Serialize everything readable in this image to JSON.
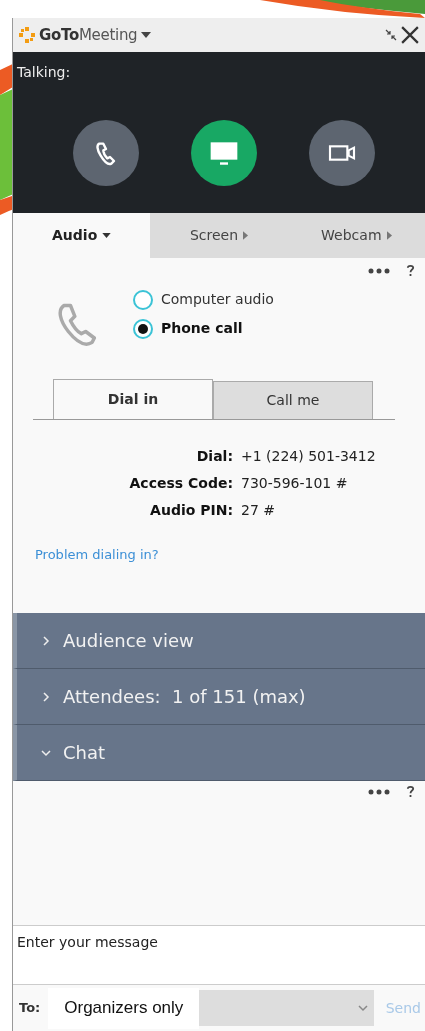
{
  "window": {
    "title": "**GoTo**Meeting"
  },
  "talking": {
    "label": "Talking:"
  },
  "call_buttons": [
    {
      "kind": "phone",
      "selected": false
    },
    {
      "kind": "screen",
      "selected": true
    },
    {
      "kind": "camera",
      "selected": false
    }
  ],
  "tabs": [
    {
      "label": "Audio",
      "selected": true
    },
    {
      "label": "Screen",
      "selected": false
    },
    {
      "label": "Webcam",
      "selected": false
    }
  ],
  "audio": {
    "options": [
      {
        "label": "Computer audio",
        "selected": false
      },
      {
        "label": "Phone call",
        "selected": true
      }
    ],
    "dial_tabs": [
      {
        "label": "Dial in",
        "selected": true
      },
      {
        "label": "Call me",
        "selected": false
      }
    ],
    "details": [
      {
        "label": "Dial:",
        "value": "+1 (224) 501-3412"
      },
      {
        "label": "Access Code:",
        "value": "730-596-101 #"
      },
      {
        "label": "Audio PIN:",
        "value": "27 #"
      }
    ],
    "link": "Problem dialing in?"
  },
  "sections": [
    {
      "label": "Audience view",
      "expanded": false
    },
    {
      "label": "Attendees:  1 of 151 (max)",
      "expanded": false
    },
    {
      "label": "Chat",
      "expanded": true
    }
  ],
  "chat": {
    "placeholder": "Enter your message",
    "to_label": "To:",
    "recipient": "Organizers only",
    "send": {
      "label": "Send",
      "disabled": true
    }
  }
}
